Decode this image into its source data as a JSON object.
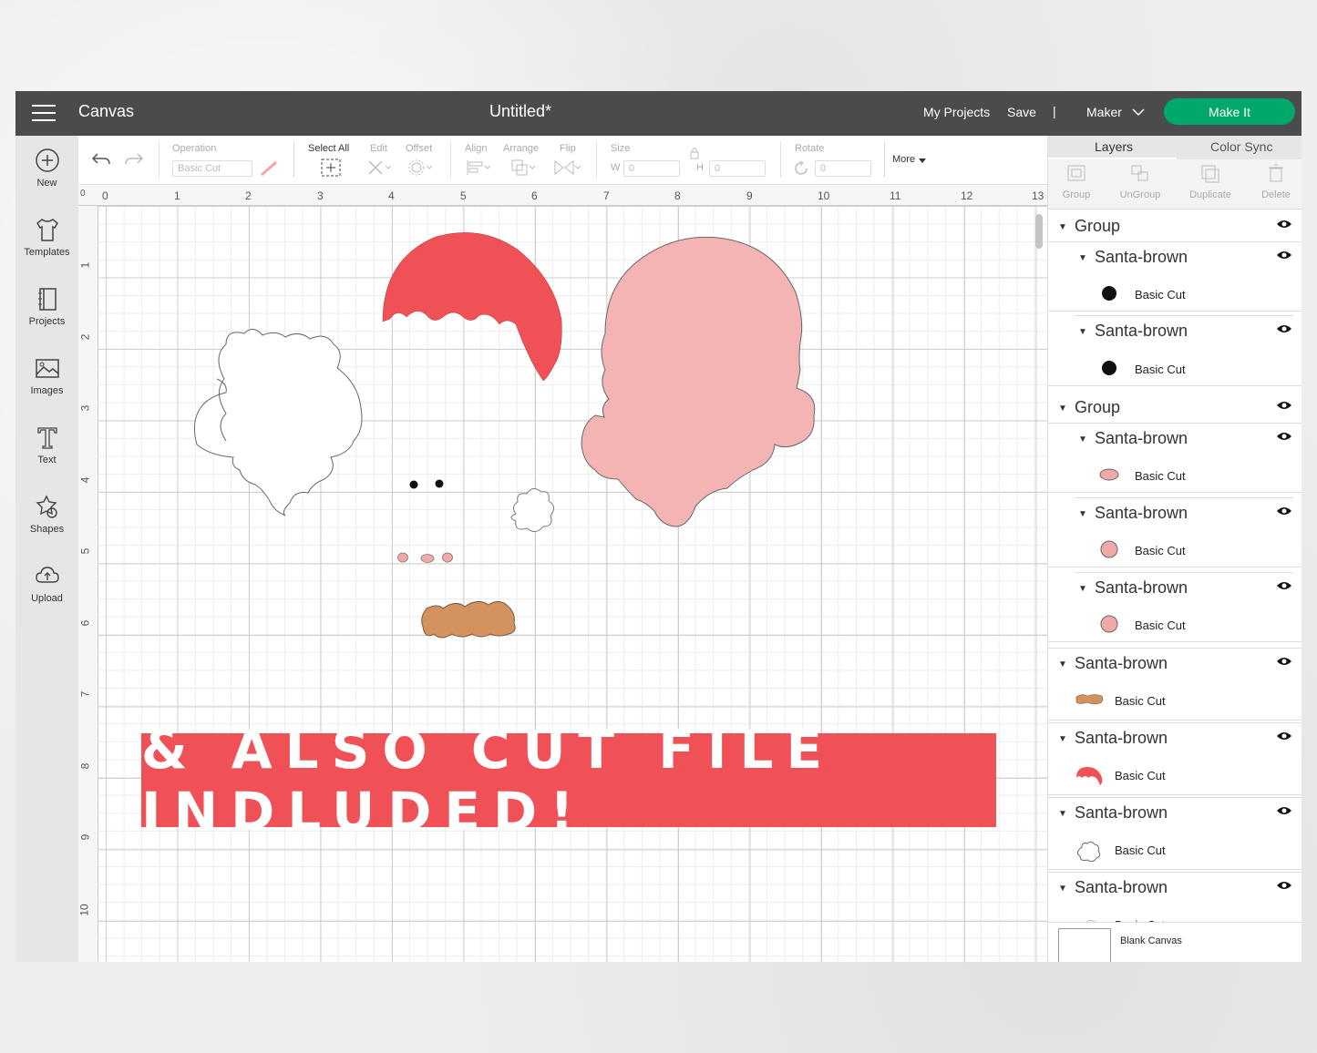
{
  "app": {
    "name": "Canvas",
    "document_title": "Untitled*",
    "links": {
      "my_projects": "My Projects",
      "save": "Save",
      "separator": "|",
      "machine": "Maker",
      "make_it": "Make It"
    },
    "colors": {
      "topbar": "#4a4b4d",
      "make_it": "#00a86b",
      "banner": "#ef5156",
      "hat_red": "#ef5156",
      "face_pink": "#f4b4b4",
      "mustache_brown": "#d4925f",
      "nose_pink": "#f0a9a9"
    }
  },
  "leftnav": [
    {
      "label": "New",
      "icon": "plus-circle-icon"
    },
    {
      "label": "Templates",
      "icon": "tshirt-icon"
    },
    {
      "label": "Projects",
      "icon": "book-icon"
    },
    {
      "label": "Images",
      "icon": "image-icon"
    },
    {
      "label": "Text",
      "icon": "text-t-icon"
    },
    {
      "label": "Shapes",
      "icon": "shapes-icon"
    },
    {
      "label": "Upload",
      "icon": "cloud-upload-icon"
    }
  ],
  "toolbar": {
    "operation": "Operation",
    "operation_value": "Basic Cut",
    "select_all": "Select All",
    "edit": "Edit",
    "offset": "Offset",
    "align": "Align",
    "arrange": "Arrange",
    "flip": "Flip",
    "size": "Size",
    "w": "W",
    "w_value": "0",
    "h": "H",
    "h_value": "0",
    "rotate": "Rotate",
    "rotate_value": "0",
    "more": "More"
  },
  "ruler": {
    "top": [
      "0",
      "1",
      "2",
      "3",
      "4",
      "5",
      "6",
      "7",
      "8",
      "9",
      "10",
      "11",
      "12",
      "13"
    ],
    "left": [
      "0",
      "1",
      "2",
      "3",
      "4",
      "5",
      "6",
      "7",
      "8",
      "9",
      "10"
    ]
  },
  "banner_text": "& ALSO CUT FILE INDLUDED!",
  "panel": {
    "tabs": [
      "Layers",
      "Color Sync"
    ],
    "actions": [
      "Group",
      "UnGroup",
      "Duplicate",
      "Delete"
    ],
    "layers": [
      {
        "type": "group",
        "name": "Group"
      },
      {
        "type": "sub",
        "name": "Santa-brown"
      },
      {
        "type": "cut",
        "label": "Basic Cut",
        "swatch": "black-dot"
      },
      {
        "type": "sub",
        "name": "Santa-brown"
      },
      {
        "type": "cut",
        "label": "Basic Cut",
        "swatch": "black-dot"
      },
      {
        "type": "group",
        "name": "Group"
      },
      {
        "type": "sub",
        "name": "Santa-brown"
      },
      {
        "type": "cut",
        "label": "Basic Cut",
        "swatch": "pink-oval"
      },
      {
        "type": "sub",
        "name": "Santa-brown"
      },
      {
        "type": "cut",
        "label": "Basic Cut",
        "swatch": "pink-circle"
      },
      {
        "type": "sub",
        "name": "Santa-brown"
      },
      {
        "type": "cut",
        "label": "Basic Cut",
        "swatch": "pink-circle"
      },
      {
        "type": "top",
        "name": "Santa-brown"
      },
      {
        "type": "cut2",
        "label": "Basic Cut",
        "swatch": "mustache"
      },
      {
        "type": "top",
        "name": "Santa-brown"
      },
      {
        "type": "cut2",
        "label": "Basic Cut",
        "swatch": "hat"
      },
      {
        "type": "top",
        "name": "Santa-brown"
      },
      {
        "type": "cut2",
        "label": "Basic Cut",
        "swatch": "cloud"
      },
      {
        "type": "top",
        "name": "Santa-brown"
      },
      {
        "type": "cut2",
        "label": "Basic Cut",
        "swatch": "cloud-partial"
      }
    ],
    "blank_canvas": "Blank Canvas"
  }
}
